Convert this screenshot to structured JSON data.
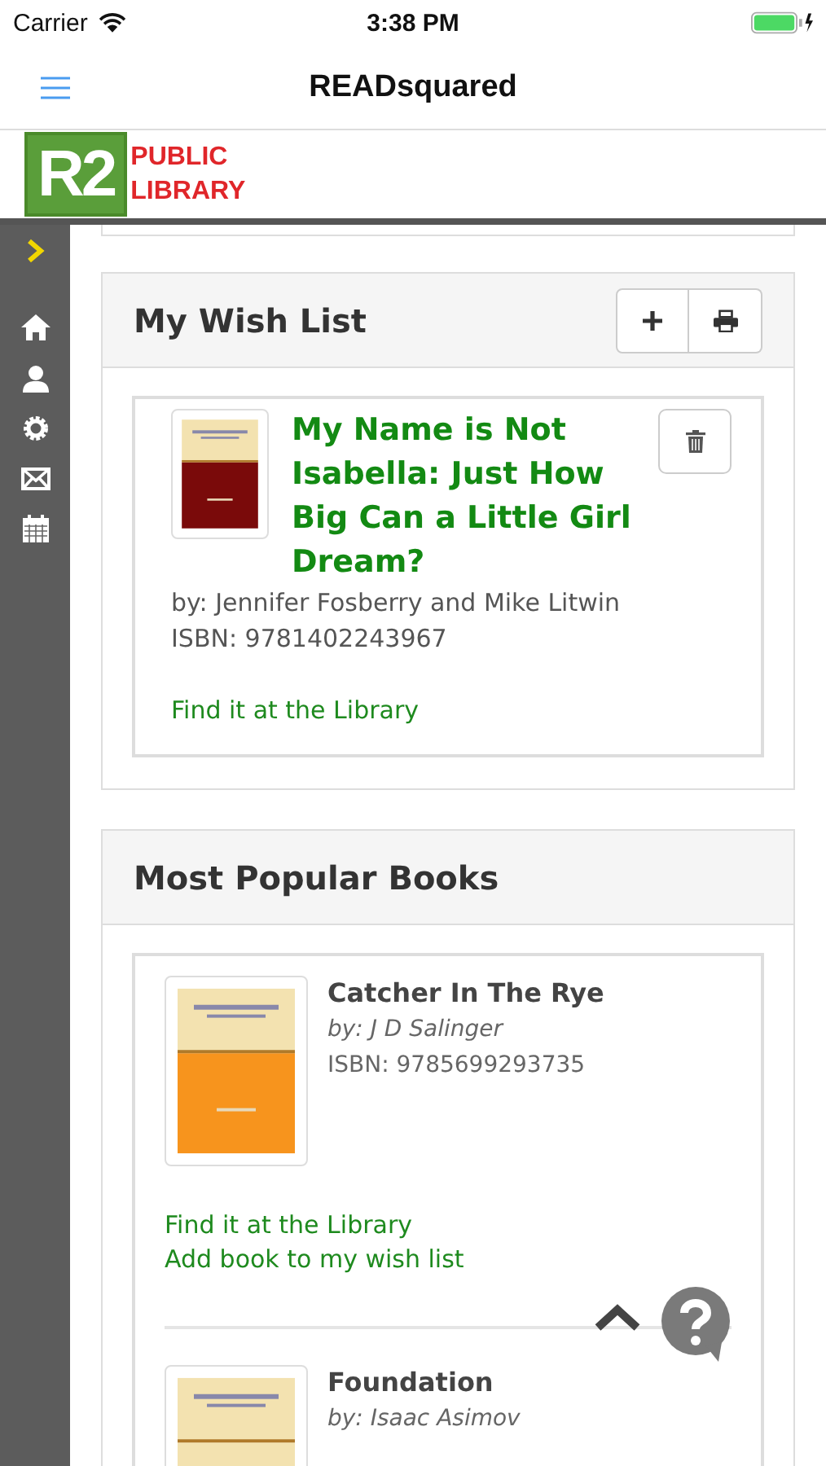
{
  "status_bar": {
    "carrier": "Carrier",
    "time": "3:38 PM"
  },
  "nav": {
    "title": "READsquared"
  },
  "logo": {
    "mark": "R2",
    "line_1": "PUBLIC",
    "line_2": "LIBRARY"
  },
  "wish_list": {
    "title": "My Wish List",
    "books": [
      {
        "title": "My Name is Not Isabella: Just How Big Can a Little Girl Dream?",
        "author": "by: Jennifer Fosberry and Mike Litwin",
        "isbn": "ISBN: 9781402243967",
        "links": [
          "Find it at the Library"
        ],
        "cover": {
          "kind": "picture"
        }
      }
    ]
  },
  "popular": {
    "title": "Most Popular Books",
    "books": [
      {
        "title": "Catcher In The Rye",
        "author": "by: J D Salinger",
        "isbn": "ISBN: 9785699293735",
        "links": [
          "Find it at the Library",
          "Add book to my wish list"
        ],
        "cover": {
          "kind": "picture"
        }
      },
      {
        "title": "Foundation",
        "author": "by: Isaac Asimov",
        "cover": {
          "kind": "picture"
        }
      }
    ]
  }
}
